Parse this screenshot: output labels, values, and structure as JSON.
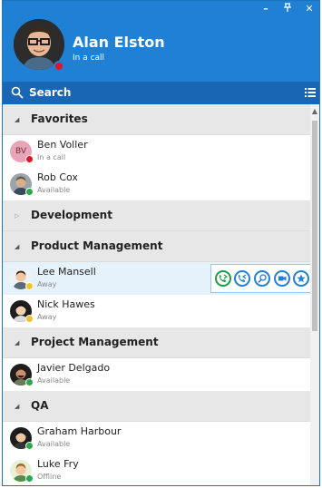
{
  "window": {
    "minimize": "–",
    "pin": "ͱ",
    "close": "✕"
  },
  "me": {
    "name": "Alan Elston",
    "status_text": "In a call",
    "status_color": "#e81123"
  },
  "search": {
    "label": "Search"
  },
  "colors": {
    "header": "#1f80d4",
    "searchbar": "#1866b4",
    "available": "#2ca84a",
    "away": "#f2c12e",
    "busy": "#e81123",
    "offline": "#2ca84a"
  },
  "groups": [
    {
      "name": "Favorites",
      "expanded": true
    },
    {
      "name": "Development",
      "expanded": false
    },
    {
      "name": "Product Management",
      "expanded": true
    },
    {
      "name": "Project Management",
      "expanded": true
    },
    {
      "name": "QA",
      "expanded": true
    }
  ],
  "contacts": {
    "ben": {
      "name": "Ben Voller",
      "status": "In a call",
      "initials": "BV"
    },
    "rob": {
      "name": "Rob Cox",
      "status": "Available"
    },
    "lee": {
      "name": "Lee Mansell",
      "status": "Away"
    },
    "nick": {
      "name": "Nick Hawes",
      "status": "Away"
    },
    "javier": {
      "name": "Javier Delgado",
      "status": "Available"
    },
    "graham": {
      "name": "Graham Harbour",
      "status": "Available"
    },
    "luke": {
      "name": "Luke Fry",
      "status": "Offline"
    }
  },
  "actions": [
    "call-icon",
    "transfer-icon",
    "search-contact-icon",
    "video-icon",
    "favorite-star-icon"
  ]
}
